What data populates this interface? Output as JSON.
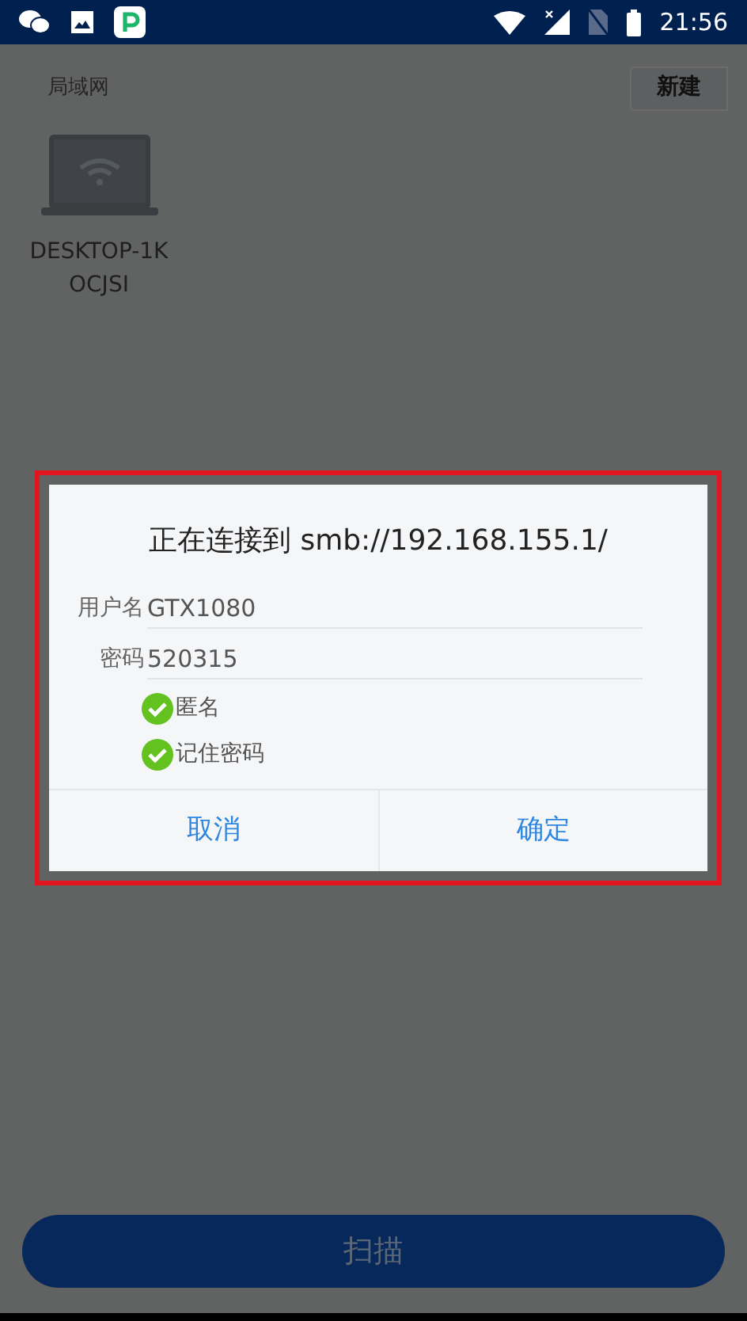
{
  "status_bar": {
    "time": "21:56"
  },
  "header": {
    "title": "局域网",
    "new_button": "新建"
  },
  "devices": [
    {
      "name": "DESKTOP-1K OCJSI"
    }
  ],
  "dialog": {
    "title": "正在连接到 smb://192.168.155.1/",
    "fields": [
      {
        "label": "用户名",
        "value": "GTX1080"
      },
      {
        "label": "密码",
        "value": "520315"
      }
    ],
    "options": [
      {
        "label": "匿名",
        "checked": true
      },
      {
        "label": "记住密码",
        "checked": true
      }
    ],
    "buttons": [
      "取消",
      "确定"
    ],
    "highlighted": true
  },
  "scan_button": "扫描"
}
